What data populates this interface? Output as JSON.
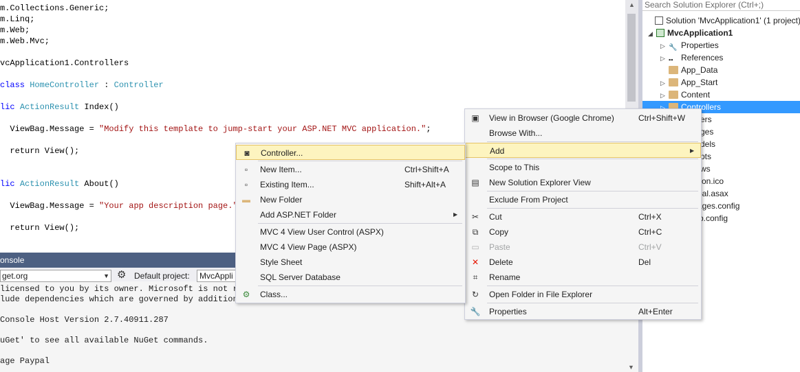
{
  "editor": {
    "lines": [
      {
        "p": "m.Collections.Generic;"
      },
      {
        "p": "m.Linq;"
      },
      {
        "p": "m.Web;"
      },
      {
        "p": "m.Web.Mvc;"
      },
      {
        "p": ""
      },
      {
        "p": "vcApplication1.Controllers"
      },
      {
        "p": ""
      },
      {
        "k": "class",
        "sp": " ",
        "t": "HomeController",
        "m": " : ",
        "t2": "Controller"
      },
      {
        "p": ""
      },
      {
        "k": "lic",
        "sp": " ",
        "t": "ActionResult",
        "m": " Index()"
      },
      {
        "p": ""
      },
      {
        "p": "  ViewBag.Message = ",
        "s": "\"Modify this template to jump-start your ASP.NET MVC application.\"",
        "e": ";"
      },
      {
        "p": ""
      },
      {
        "p": "  return View();"
      },
      {
        "p": ""
      },
      {
        "p": ""
      },
      {
        "k": "lic",
        "sp": " ",
        "t": "ActionResult",
        "m": " About()"
      },
      {
        "p": ""
      },
      {
        "p": "  ViewBag.Message = ",
        "s": "\"Your app description page.\"",
        "e": ";"
      },
      {
        "p": ""
      },
      {
        "p": "  return View();"
      }
    ]
  },
  "console": {
    "title": "onsole",
    "source": "get.org",
    "default_project_label": "Default project:",
    "default_project": "MvcAppli",
    "lines": [
      "licensed to you by its owner. Microsoft is not re",
      "lude dependencies which are governed by additiona",
      "",
      "Console Host Version 2.7.40911.287",
      "",
      "uGet' to see all available NuGet commands.",
      "",
      "age Paypal"
    ]
  },
  "solution_explorer": {
    "search_placeholder": "Search Solution Explorer (Ctrl+;)",
    "nodes": [
      {
        "label": "Solution 'MvcApplication1' (1 project)",
        "icon": "solution-icon"
      },
      {
        "label": "MvcApplication1",
        "icon": "web-project-icon"
      },
      {
        "label": "Properties",
        "icon": "wrench-icon"
      },
      {
        "label": "References",
        "icon": "references-icon"
      },
      {
        "label": "App_Data",
        "icon": "folder-icon"
      },
      {
        "label": "App_Start",
        "icon": "folder-icon"
      },
      {
        "label": "Content",
        "icon": "folder-icon"
      },
      {
        "label": "Controllers",
        "icon": "folder-icon"
      },
      {
        "label": "ers"
      },
      {
        "label": "ges"
      },
      {
        "label": "dels"
      },
      {
        "label": "pts"
      },
      {
        "label": "ws"
      },
      {
        "label": "con.ico"
      },
      {
        "label": "bal.asax"
      },
      {
        "label": "kages.config"
      },
      {
        "label": "b.config"
      }
    ]
  },
  "context_menu": {
    "items": [
      {
        "label": "View in Browser (Google Chrome)",
        "shortcut": "Ctrl+Shift+W",
        "icon": "browser-icon"
      },
      {
        "label": "Browse With..."
      },
      {
        "label": "Add",
        "submenu": true
      },
      {
        "label": "Scope to This"
      },
      {
        "label": "New Solution Explorer View",
        "icon": "new-view-icon"
      },
      {
        "label": "Exclude From Project"
      },
      {
        "label": "Cut",
        "shortcut": "Ctrl+X",
        "icon": "cut-icon"
      },
      {
        "label": "Copy",
        "shortcut": "Ctrl+C",
        "icon": "copy-icon"
      },
      {
        "label": "Paste",
        "shortcut": "Ctrl+V",
        "icon": "paste-icon",
        "disabled": true
      },
      {
        "label": "Delete",
        "shortcut": "Del",
        "icon": "delete-icon"
      },
      {
        "label": "Rename",
        "icon": "rename-icon"
      },
      {
        "label": "Open Folder in File Explorer",
        "icon": "open-folder-icon"
      },
      {
        "label": "Properties",
        "shortcut": "Alt+Enter",
        "icon": "wrench-icon"
      }
    ]
  },
  "add_submenu": {
    "items": [
      {
        "label": "Controller...",
        "icon": "controller-icon"
      },
      {
        "label": "New Item...",
        "shortcut": "Ctrl+Shift+A",
        "icon": "new-item-icon"
      },
      {
        "label": "Existing Item...",
        "shortcut": "Shift+Alt+A",
        "icon": "existing-item-icon"
      },
      {
        "label": "New Folder",
        "icon": "new-folder-icon"
      },
      {
        "label": "Add ASP.NET Folder",
        "submenu": true
      },
      {
        "label": "MVC 4 View User Control (ASPX)"
      },
      {
        "label": "MVC 4 View Page (ASPX)"
      },
      {
        "label": "Style Sheet"
      },
      {
        "label": "SQL Server Database"
      },
      {
        "label": "Class...",
        "icon": "class-icon"
      }
    ]
  },
  "colors": {
    "highlight": "#fdf4bf",
    "selection": "#3399ff",
    "console_title_bg": "#4d6082",
    "keyword": "#0000ff",
    "type": "#2b91af",
    "string": "#a31515"
  }
}
